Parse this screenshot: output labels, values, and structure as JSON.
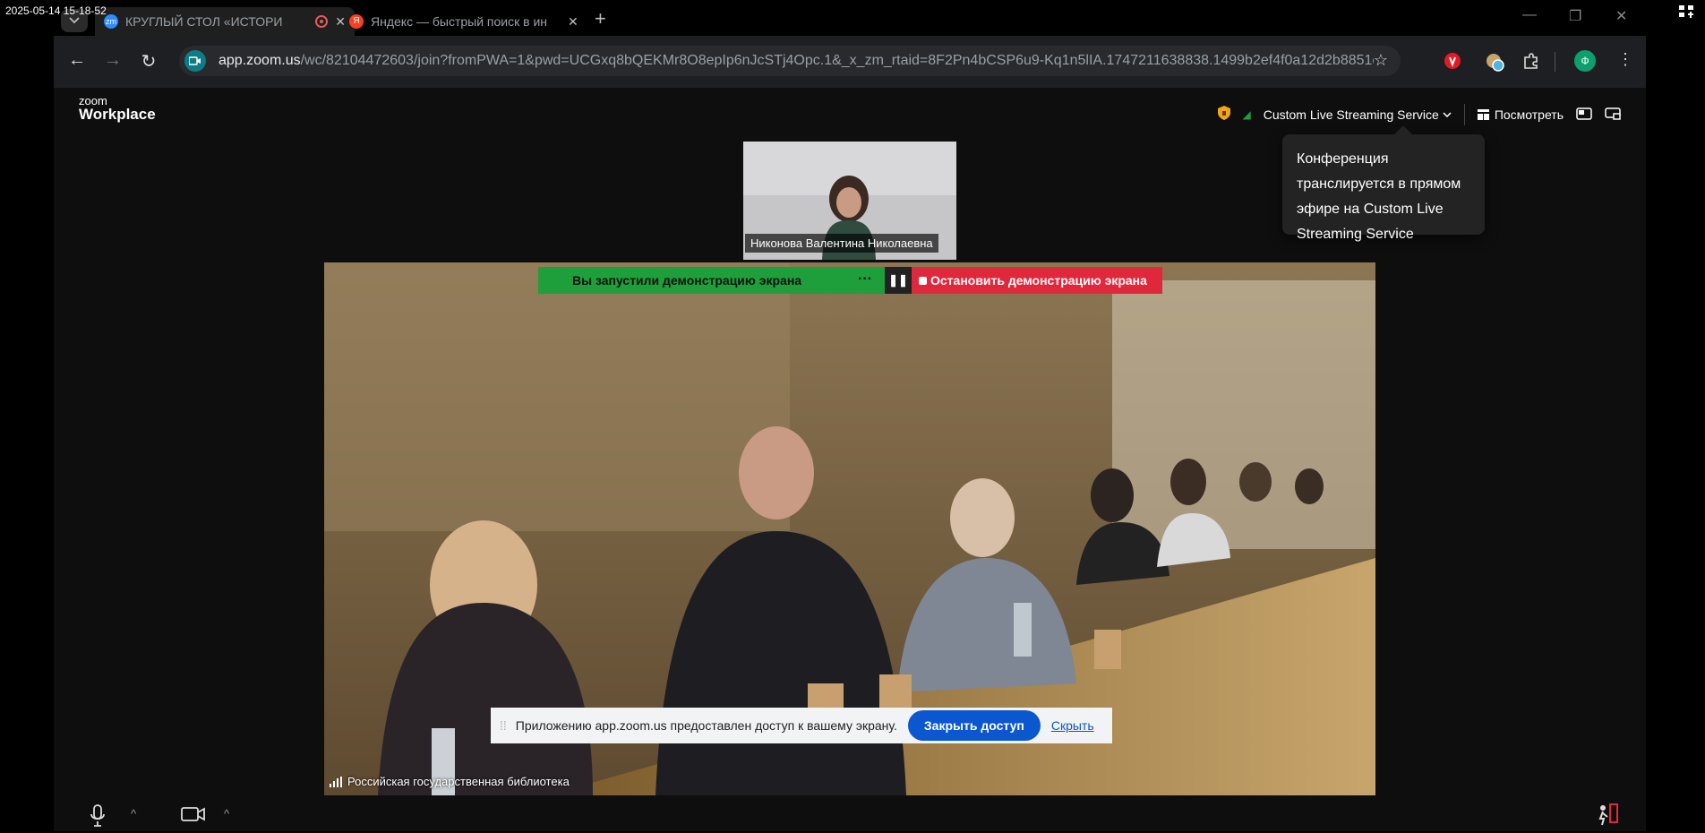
{
  "overlay": {
    "timestamp": "2025-05-14 15-18-52",
    "corner_glyph": "⬛"
  },
  "browser": {
    "tabs": [
      {
        "title": "КРУГЛЫЙ СТОЛ «ИСТОРИ",
        "favicon": "zm",
        "favicon_color": "#2d8cff",
        "recording_icon": "record-icon"
      },
      {
        "title": "Яндекс — быстрый поиск в ин",
        "favicon": "Я",
        "favicon_color": "#fc3f1d"
      }
    ],
    "new_tab_label": "+",
    "window_controls": {
      "minimize": "—",
      "maximize": "❐",
      "close": "✕"
    },
    "nav": {
      "back": "←",
      "forward": "→",
      "reload": "↻"
    },
    "address": {
      "host": "app.zoom.us",
      "path": "/wc/82104472603/join?fromPWA=1&pwd=UCGxq8bQEKMr8O8epIp6nJcSTj4Opc.1&_x_zm_rtaid=8F2Pn4bCSP6u9-Kq1n5lIA.1747211638838.1499b2ef4f0a12d2b8851c..."
    },
    "star": "☆",
    "profile_initial": "Ф",
    "colors": {
      "profile": "#0e9f6e",
      "ext_red": "#e01b24"
    }
  },
  "zoom": {
    "logo_small": "zoom",
    "logo_big": "Workplace",
    "header": {
      "live_service": "Custom Live Streaming Service",
      "view_label": "Посмотреть"
    },
    "tooltip": "Конференция транслируется в прямом эфире на Custom Live Streaming Service",
    "thumbnail_name": "Никонова Валентина Николаевна",
    "main_video_name": "Российская государственная библиотека",
    "share_banner": {
      "status": "Вы запустили демонстрацию экрана",
      "more": "···",
      "pause": "❚❚",
      "stop": "Остановить демонстрацию экрана"
    },
    "bottom": {
      "mic_icon": "🎙",
      "video_icon": "📹",
      "caret": "^"
    }
  },
  "share_notice": {
    "text": "Приложению app.zoom.us предоставлен доступ к вашему экрану.",
    "stop_button": "Закрыть доступ",
    "hide_link": "Скрыть"
  }
}
